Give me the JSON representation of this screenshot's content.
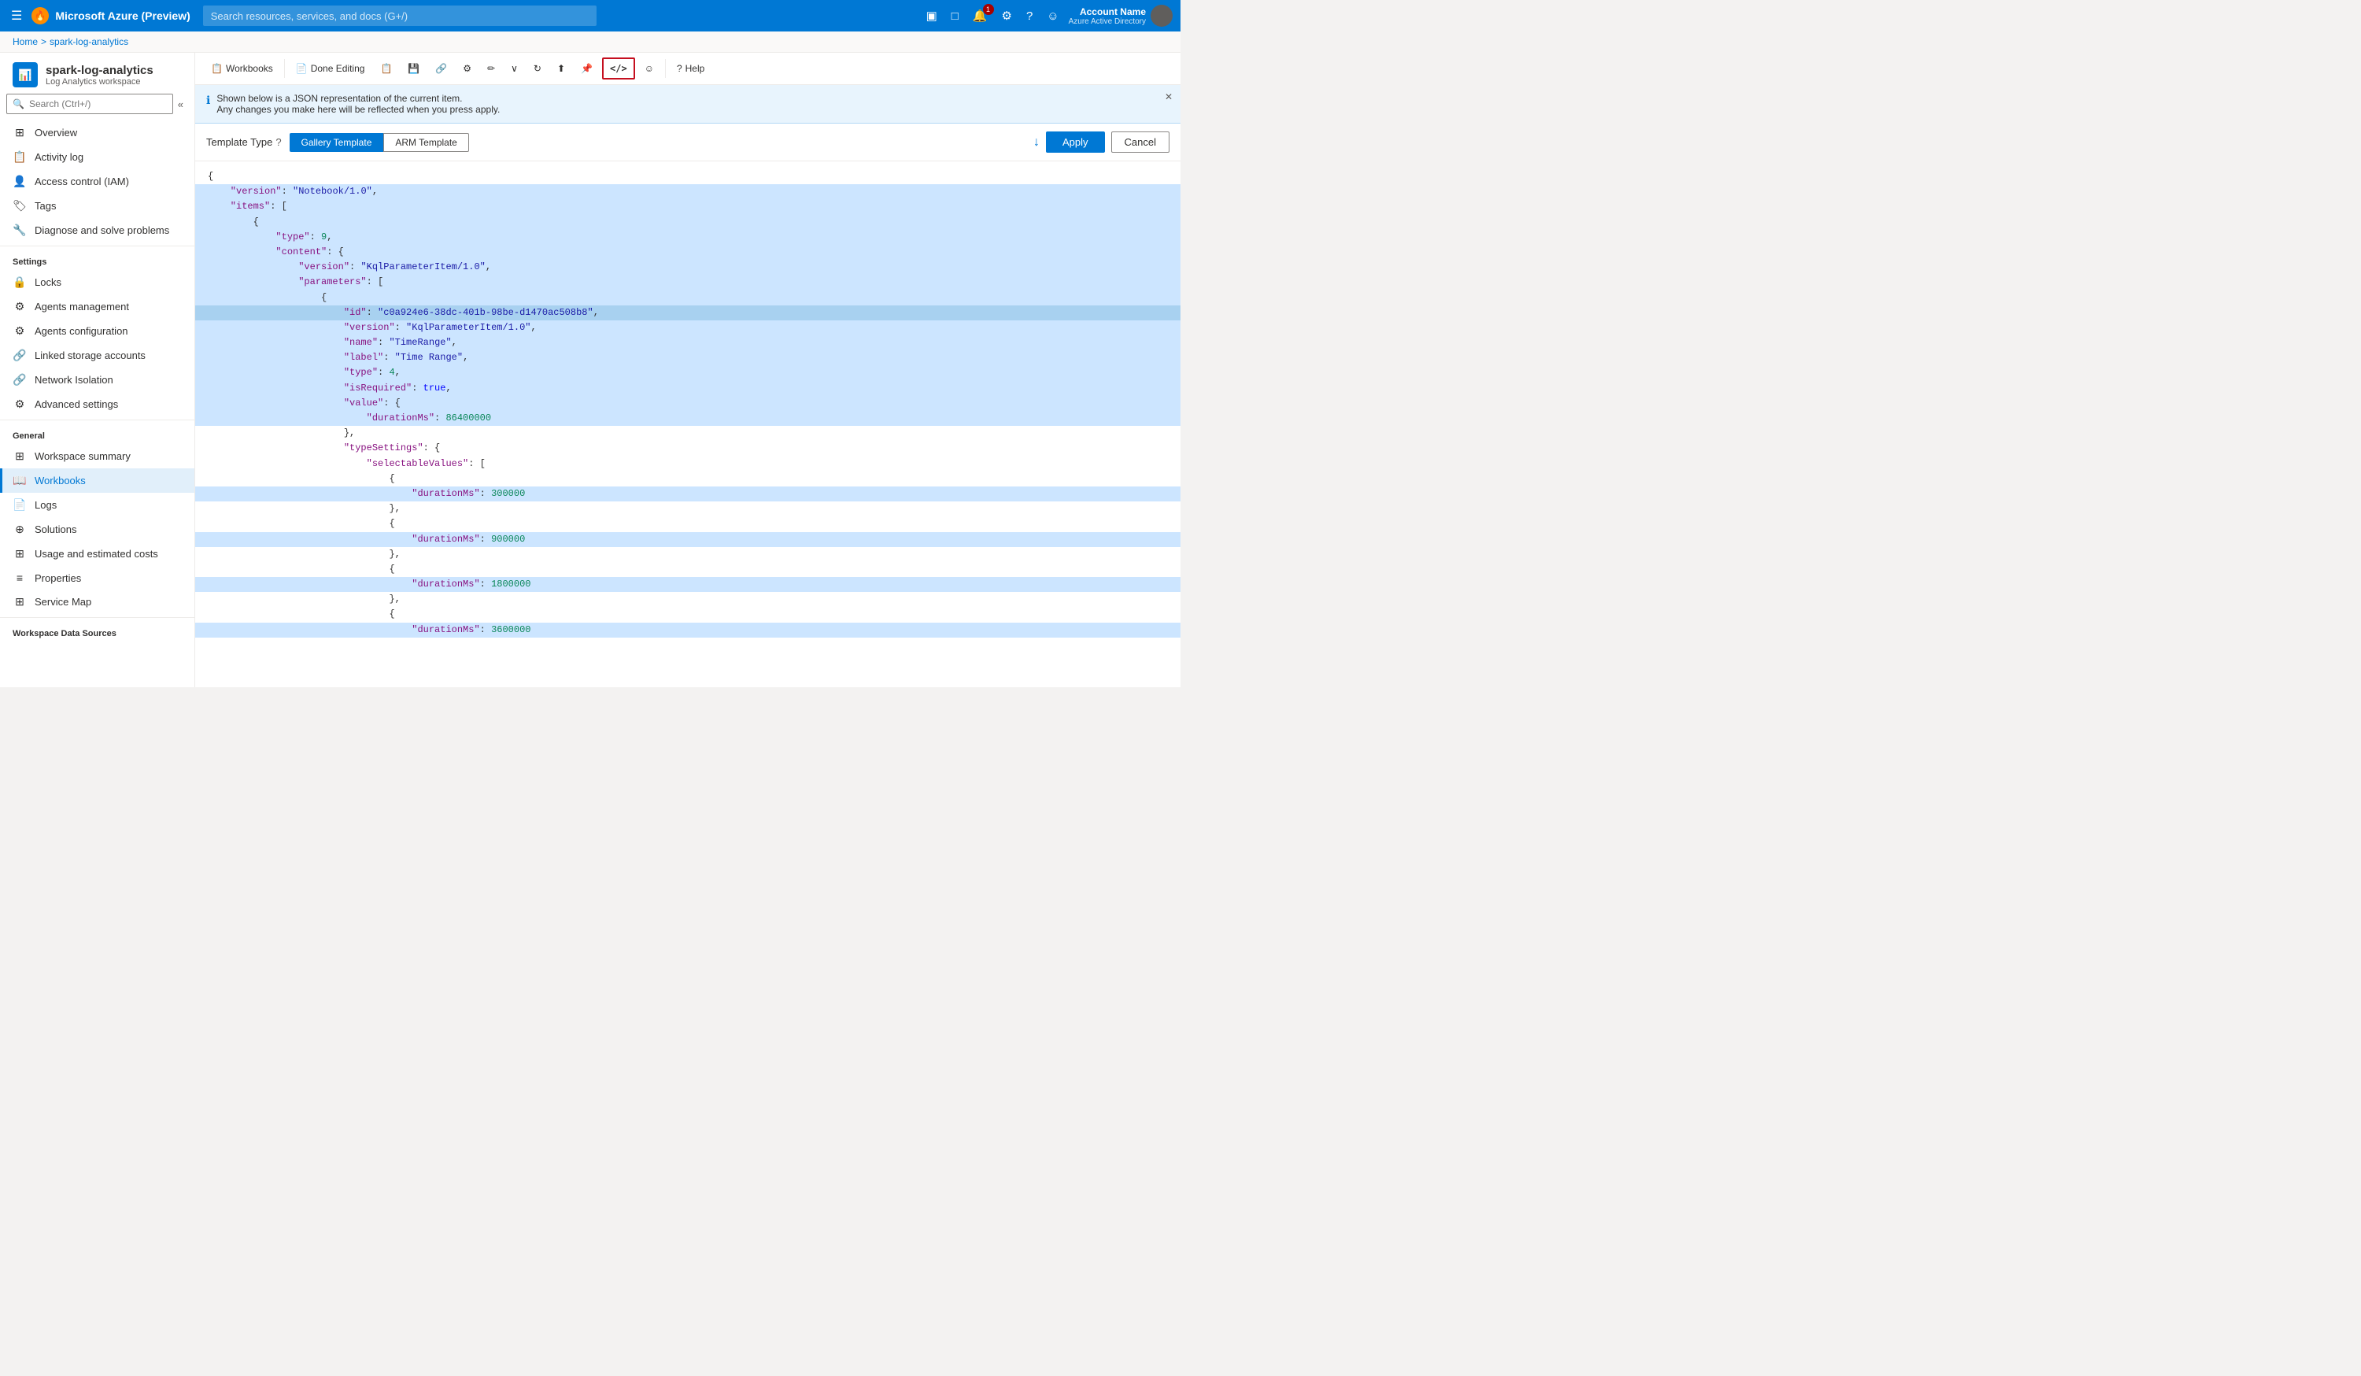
{
  "topbar": {
    "hamburger": "☰",
    "brand": "Microsoft Azure (Preview)",
    "search_placeholder": "Search resources, services, and docs (G+/)",
    "account_name": "Account Name",
    "account_sub": "Azure Active Directory",
    "notification_count": "1"
  },
  "breadcrumb": {
    "home": "Home",
    "separator": ">",
    "current": "spark-log-analytics"
  },
  "sidebar": {
    "search_placeholder": "Search (Ctrl+/)",
    "resource_title": "spark-log-analytics",
    "resource_sub": "Log Analytics workspace",
    "nav_items": [
      {
        "id": "overview",
        "label": "Overview",
        "icon": "⊞",
        "section": null
      },
      {
        "id": "activity-log",
        "label": "Activity log",
        "icon": "📋",
        "section": null
      },
      {
        "id": "access-control",
        "label": "Access control (IAM)",
        "icon": "👤",
        "section": null
      },
      {
        "id": "tags",
        "label": "Tags",
        "icon": "🏷",
        "section": null
      },
      {
        "id": "diagnose",
        "label": "Diagnose and solve problems",
        "icon": "🔧",
        "section": null
      },
      {
        "id": "settings-header",
        "label": "Settings",
        "section": "Settings"
      },
      {
        "id": "locks",
        "label": "Locks",
        "icon": "🔒",
        "section": null
      },
      {
        "id": "agents-mgmt",
        "label": "Agents management",
        "icon": "⚙",
        "section": null
      },
      {
        "id": "agents-config",
        "label": "Agents configuration",
        "icon": "⚙",
        "section": null
      },
      {
        "id": "linked-storage",
        "label": "Linked storage accounts",
        "icon": "🔗",
        "section": null
      },
      {
        "id": "network-isolation",
        "label": "Network Isolation",
        "icon": "🔗",
        "section": null
      },
      {
        "id": "advanced-settings",
        "label": "Advanced settings",
        "icon": "⚙",
        "section": null
      },
      {
        "id": "general-header",
        "label": "General",
        "section": "General"
      },
      {
        "id": "workspace-summary",
        "label": "Workspace summary",
        "icon": "⊞",
        "section": null
      },
      {
        "id": "workbooks",
        "label": "Workbooks",
        "icon": "📖",
        "section": null,
        "active": true
      },
      {
        "id": "logs",
        "label": "Logs",
        "icon": "📄",
        "section": null
      },
      {
        "id": "solutions",
        "label": "Solutions",
        "icon": "⊕",
        "section": null
      },
      {
        "id": "usage-costs",
        "label": "Usage and estimated costs",
        "icon": "⊞",
        "section": null
      },
      {
        "id": "properties",
        "label": "Properties",
        "icon": "≡",
        "section": null
      },
      {
        "id": "service-map",
        "label": "Service Map",
        "icon": "⊞",
        "section": null
      },
      {
        "id": "workspace-data-header",
        "label": "Workspace Data Sources",
        "section": "Workspace Data Sources"
      }
    ]
  },
  "toolbar": {
    "workbooks_label": "Workbooks",
    "done_editing_label": "Done Editing",
    "code_icon": "</>",
    "help_label": "Help"
  },
  "info_panel": {
    "message_line1": "Shown below is a JSON representation of the current item.",
    "message_line2": "Any changes you make here will be reflected when you press apply."
  },
  "template_type": {
    "label": "Template Type",
    "tabs": [
      "Gallery Template",
      "ARM Template"
    ],
    "selected_tab": "Gallery Template",
    "apply_label": "Apply",
    "cancel_label": "Cancel"
  },
  "json_editor": {
    "lines": [
      {
        "text": "{",
        "type": "brace",
        "highlight": false
      },
      {
        "text": "    \"version\": \"Notebook/1.0\",",
        "type": "key-str",
        "highlight": true,
        "key": "version",
        "value": "Notebook/1.0"
      },
      {
        "text": "    \"items\": [",
        "type": "key-arr",
        "highlight": true
      },
      {
        "text": "        {",
        "type": "brace",
        "highlight": true
      },
      {
        "text": "            \"type\": 9,",
        "type": "key-num",
        "highlight": true
      },
      {
        "text": "            \"content\": {",
        "type": "key-obj",
        "highlight": true
      },
      {
        "text": "                \"version\": \"KqlParameterItem/1.0\",",
        "type": "key-str",
        "highlight": true
      },
      {
        "text": "                \"parameters\": [",
        "type": "key-arr",
        "highlight": true
      },
      {
        "text": "                    {",
        "type": "brace",
        "highlight": true
      },
      {
        "text": "                        \"id\": \"c0a924e6-38dc-401b-98be-d1470ac508b8\",",
        "type": "key-str",
        "highlight": true,
        "special": true
      },
      {
        "text": "                        \"version\": \"KqlParameterItem/1.0\",",
        "type": "key-str",
        "highlight": true
      },
      {
        "text": "                        \"name\": \"TimeRange\",",
        "type": "key-str",
        "highlight": true
      },
      {
        "text": "                        \"label\": \"Time Range\",",
        "type": "key-str",
        "highlight": true
      },
      {
        "text": "                        \"type\": 4,",
        "type": "key-num",
        "highlight": true
      },
      {
        "text": "                        \"isRequired\": true,",
        "type": "key-bool",
        "highlight": true
      },
      {
        "text": "                        \"value\": {",
        "type": "key-obj",
        "highlight": true
      },
      {
        "text": "                            \"durationMs\": 86400000",
        "type": "key-num",
        "highlight": true
      },
      {
        "text": "                        },",
        "type": "brace",
        "highlight": false
      },
      {
        "text": "                        \"typeSettings\": {",
        "type": "key-obj",
        "highlight": false
      },
      {
        "text": "                            \"selectableValues\": [",
        "type": "key-arr",
        "highlight": false
      },
      {
        "text": "                                {",
        "type": "brace",
        "highlight": false
      },
      {
        "text": "                                    \"durationMs\": 300000",
        "type": "key-num",
        "highlight": true
      },
      {
        "text": "                                },",
        "type": "brace",
        "highlight": false
      },
      {
        "text": "                                {",
        "type": "brace",
        "highlight": false
      },
      {
        "text": "                                    \"durationMs\": 900000",
        "type": "key-num",
        "highlight": true
      },
      {
        "text": "                                },",
        "type": "brace",
        "highlight": false
      },
      {
        "text": "                                {",
        "type": "brace",
        "highlight": false
      },
      {
        "text": "                                    \"durationMs\": 1800000",
        "type": "key-num",
        "highlight": true
      },
      {
        "text": "                                },",
        "type": "brace",
        "highlight": false
      },
      {
        "text": "                                {",
        "type": "brace",
        "highlight": false
      },
      {
        "text": "                                    \"durationMs\": 3600000",
        "type": "key-num",
        "highlight": true
      }
    ]
  }
}
